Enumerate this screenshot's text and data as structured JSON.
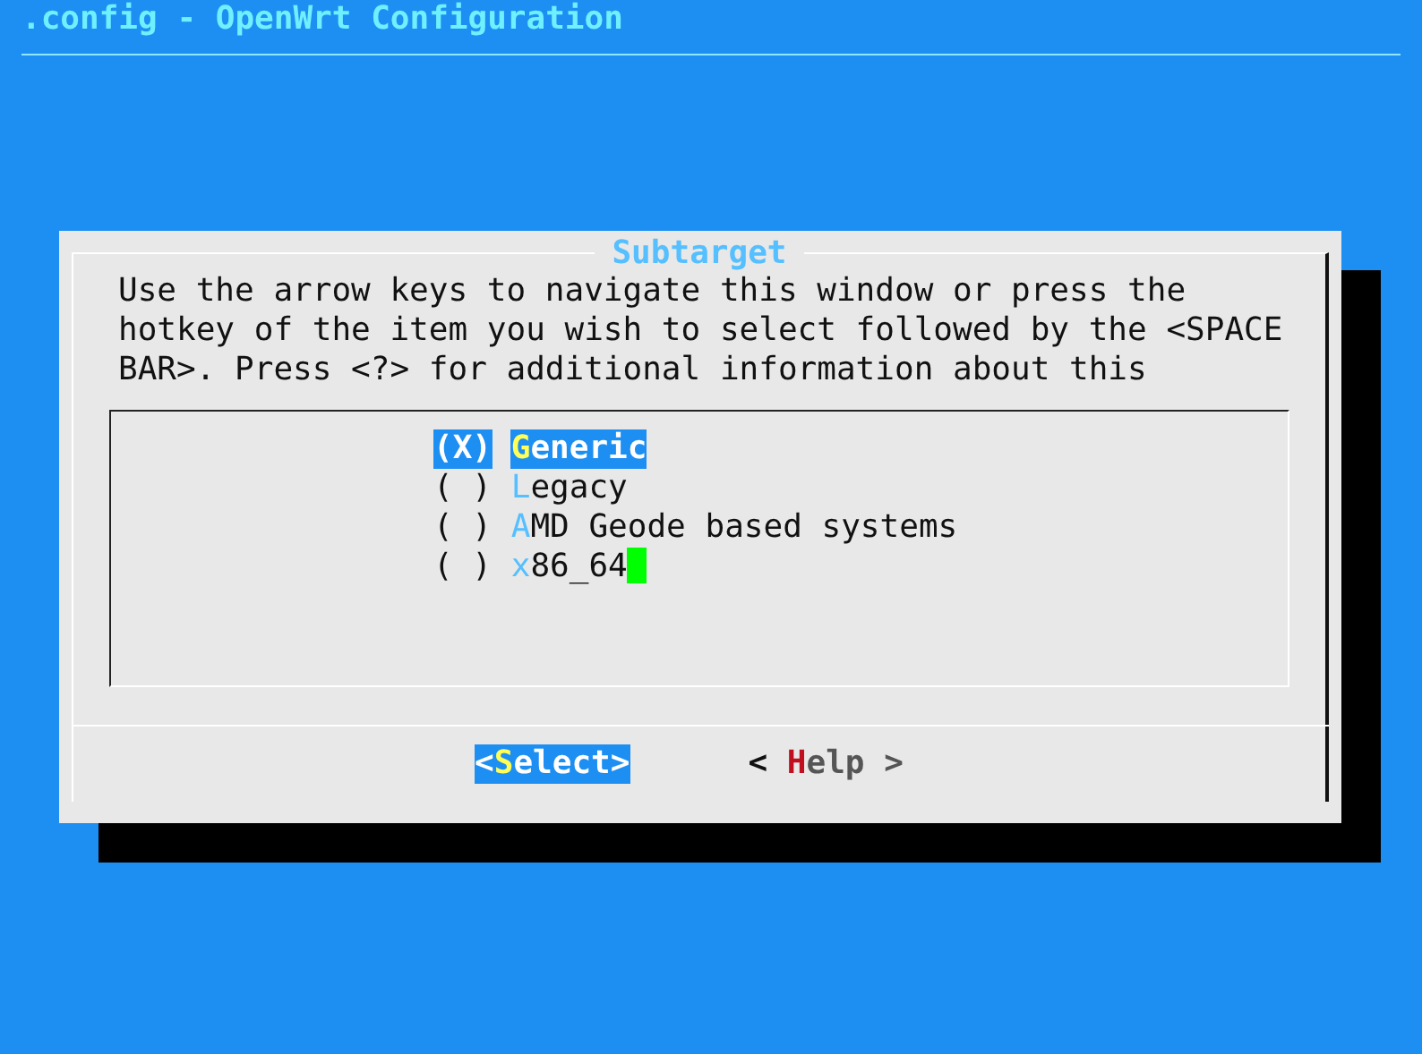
{
  "window": {
    "title": ".config - OpenWrt Configuration"
  },
  "dialog": {
    "title": "Subtarget",
    "instructions": [
      "Use the arrow keys to navigate this window or press the",
      "hotkey of the item you wish to select followed by the <SPACE",
      "BAR>. Press <?> for additional information about this"
    ],
    "items": [
      {
        "mark": "(X)",
        "hotkey": "G",
        "rest": "eneric",
        "selected": true
      },
      {
        "mark": "( )",
        "hotkey": "L",
        "rest": "egacy",
        "selected": false
      },
      {
        "mark": "( )",
        "hotkey": "A",
        "rest": "MD Geode based systems",
        "selected": false
      },
      {
        "mark": "( )",
        "hotkey": "x",
        "rest": "86_64",
        "selected": false
      }
    ],
    "buttons": [
      {
        "before": "<",
        "hotkey": "S",
        "after": "elect>",
        "selected": true
      },
      {
        "before": "< ",
        "hotkey": "H",
        "after": "elp >",
        "selected": false
      }
    ]
  }
}
